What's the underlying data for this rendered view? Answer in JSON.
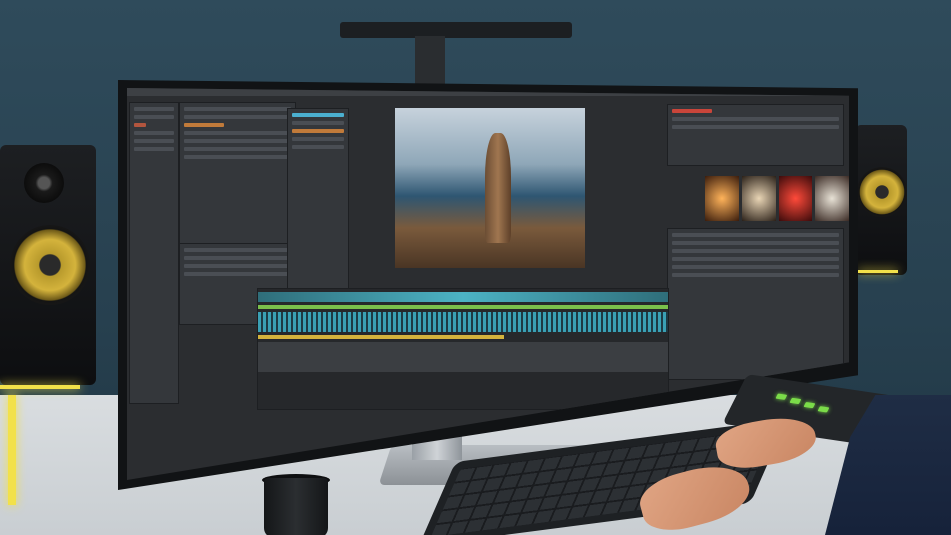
{
  "scene": {
    "description_free": true,
    "accent": "#d4b33c",
    "led_color": "#7bdc49",
    "wall_color": "#2f4b5b",
    "desk_color": "#d9dde0"
  },
  "monitor": {
    "logo_text": "",
    "screen_app": {
      "preview_image_name": "sea-rock-photo-icon",
      "thumbnails": [
        "fire-thumb",
        "figure-thumb",
        "red-burst-thumb",
        "portrait-thumb"
      ]
    }
  }
}
